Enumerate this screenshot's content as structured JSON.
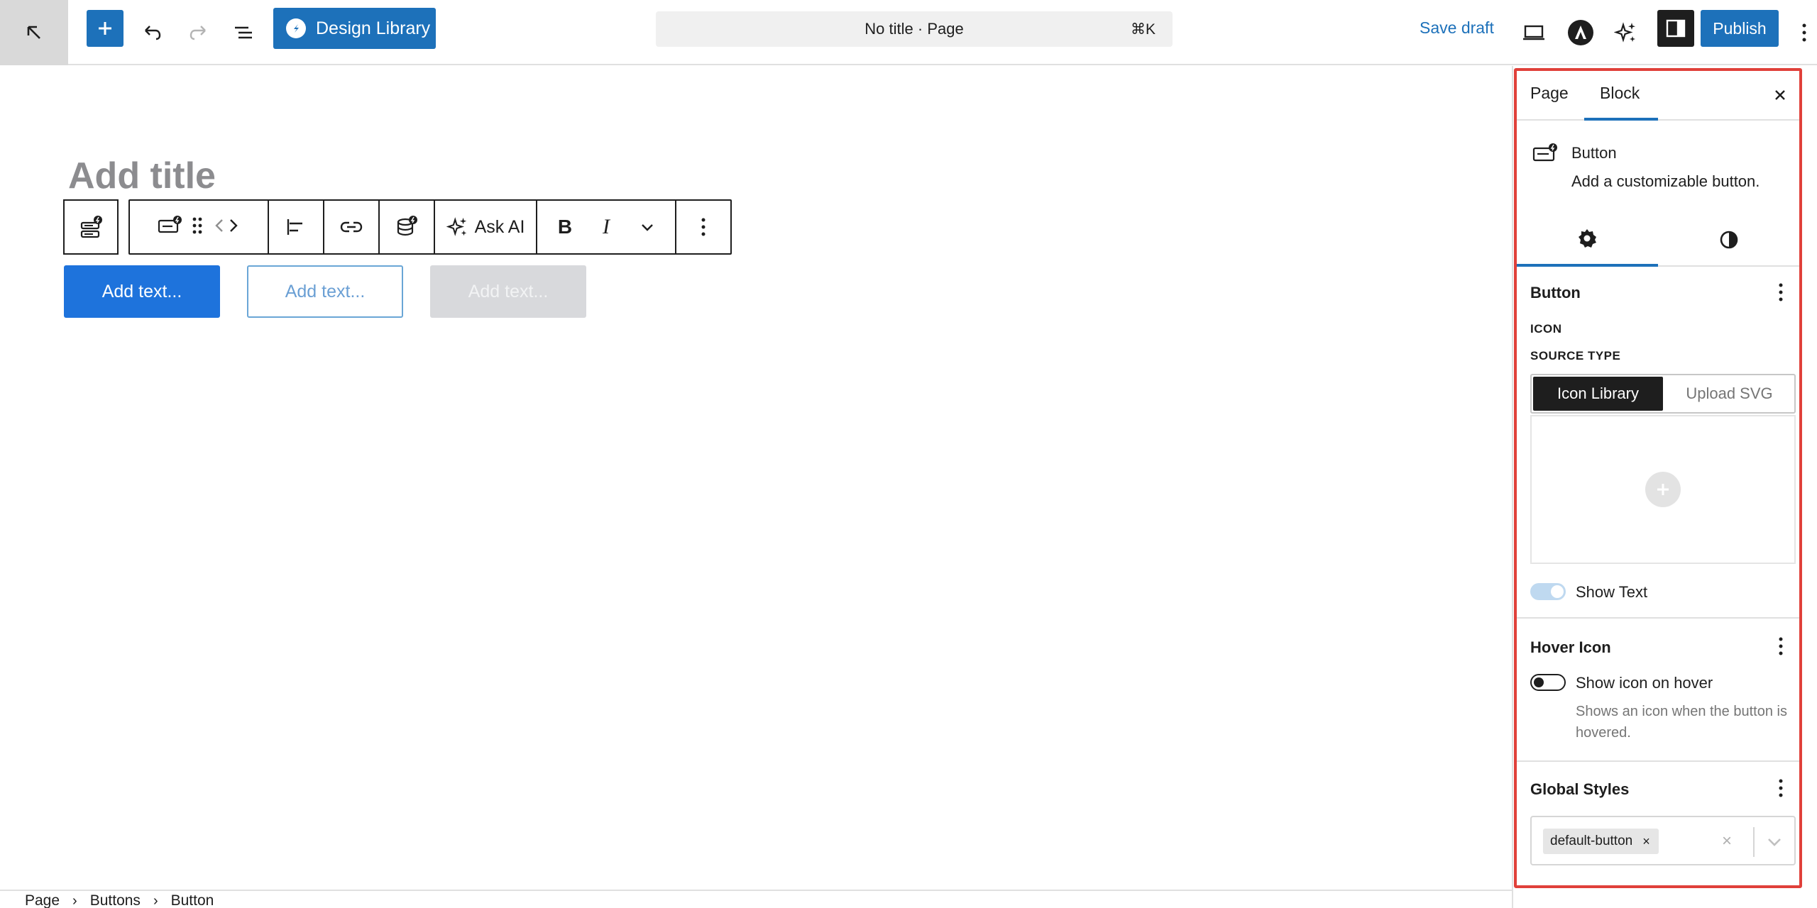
{
  "topbar": {
    "design_library_label": "Design Library",
    "command_bar_title": "No title · Page",
    "command_bar_shortcut": "⌘K",
    "save_draft_label": "Save draft",
    "publish_label": "Publish"
  },
  "editor": {
    "title_placeholder": "Add title",
    "toolbar": {
      "ask_ai_label": "Ask AI",
      "bold_label": "B",
      "italic_label": "I"
    },
    "buttons": [
      "Add text...",
      "Add text...",
      "Add text..."
    ]
  },
  "breadcrumb": {
    "items": [
      "Page",
      "Buttons",
      "Button"
    ],
    "separator": "›"
  },
  "sidebar": {
    "tabs": {
      "page": "Page",
      "block": "Block"
    },
    "block_card": {
      "title": "Button",
      "description": "Add a customizable button."
    },
    "button_panel": {
      "title": "Button",
      "icon_label": "ICON",
      "source_type_label": "SOURCE TYPE",
      "source_options": [
        "Icon Library",
        "Upload SVG"
      ],
      "selected_source": "Icon Library",
      "show_text_label": "Show Text",
      "show_text_enabled": true
    },
    "hover_icon_panel": {
      "title": "Hover Icon",
      "toggle_label": "Show icon on hover",
      "toggle_enabled": false,
      "help_text": "Shows an icon when the button is hovered."
    },
    "global_styles_panel": {
      "title": "Global Styles",
      "selected_chip": "default-button",
      "chip_remove": "×",
      "clear_icon": "×"
    }
  },
  "colors": {
    "accent": "#1d71ba",
    "highlight_frame": "#e0403a",
    "primary_button": "#1e73dc",
    "dark": "#1e1e1e"
  },
  "icons": [
    "arrow-up-left-icon",
    "plus-icon",
    "undo-icon",
    "redo-icon",
    "list-view-icon",
    "spectra-logo-icon",
    "desktop-preview-icon",
    "astra-logo-icon",
    "sparkle-ai-icon",
    "sidebar-toggle-icon",
    "more-vertical-icon",
    "close-icon",
    "button-block-icon",
    "gear-icon",
    "contrast-icon",
    "bold-icon",
    "italic-icon",
    "chevron-down-icon"
  ]
}
